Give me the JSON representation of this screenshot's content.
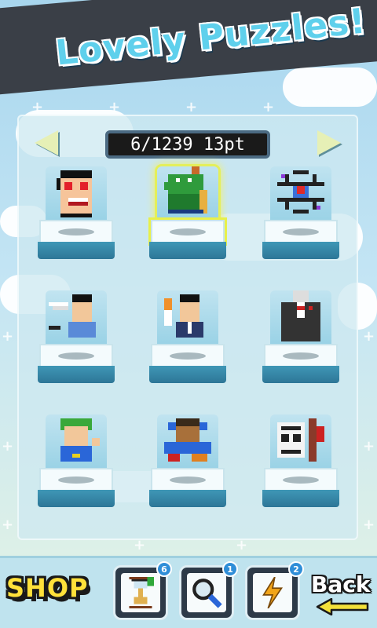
{
  "header": {
    "title": "Lovely Puzzles!"
  },
  "navigation": {
    "counter_text": "6/1239 13pt",
    "prev_icon": "arrow-left-icon",
    "next_icon": "arrow-right-icon"
  },
  "puzzles": [
    {
      "icon": "heart-eyes-face-icon",
      "selected": false
    },
    {
      "icon": "green-dragon-icon",
      "selected": true
    },
    {
      "icon": "atom-molecule-icon",
      "selected": false
    },
    {
      "icon": "man-with-paper-plane-icon",
      "selected": false
    },
    {
      "icon": "man-with-torch-icon",
      "selected": false
    },
    {
      "icon": "man-in-suit-icon",
      "selected": false
    },
    {
      "icon": "green-hair-hero-icon",
      "selected": false
    },
    {
      "icon": "man-at-table-icon",
      "selected": false
    },
    {
      "icon": "robot-tablet-icon",
      "selected": false
    }
  ],
  "toolbar": {
    "shop_label": "SHOP",
    "items": [
      {
        "icon": "hourglass-icon",
        "count": "6"
      },
      {
        "icon": "magnifier-icon",
        "count": "1"
      },
      {
        "icon": "lightning-icon",
        "count": "2"
      }
    ],
    "back_label": "Back"
  },
  "colors": {
    "accent": "#5fd0ec",
    "highlight": "#e8f04a",
    "shop": "#ffe13a"
  }
}
